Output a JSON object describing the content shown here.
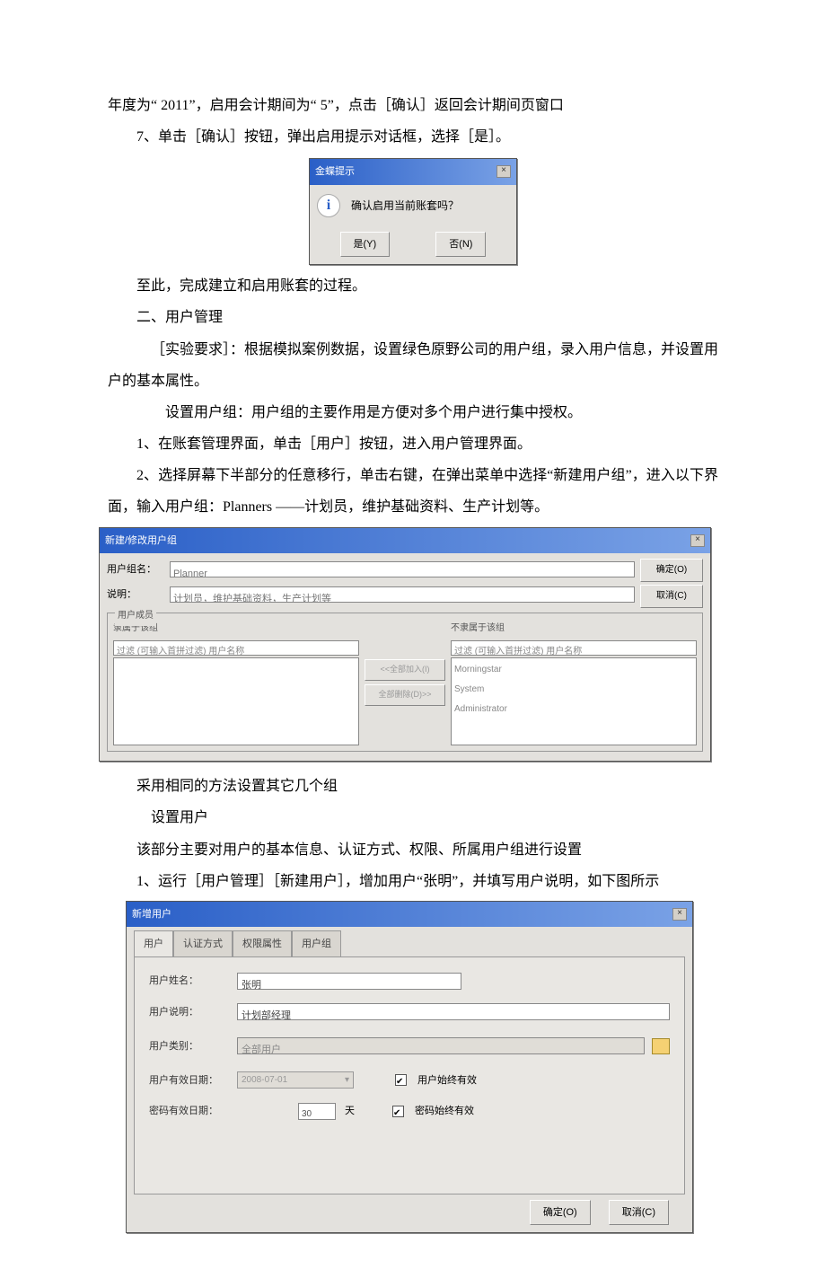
{
  "p_lead": "年度为“ 2011”，启用会计期间为“ 5”，点击［确认］返回会计期间页窗口",
  "p_step7": "7、单击［确认］按钮，弹出启用提示对话框，选择［是］。",
  "dlg_confirm": {
    "title": "金蝶提示",
    "message": "确认启用当前账套吗？",
    "btn_yes": "是(Y)",
    "btn_no": "否(N)"
  },
  "p_done": "至此，完成建立和启用账套的过程。",
  "p_h2": "二、用户管理",
  "p_req": "［实验要求］：根据模拟案例数据，设置绿色原野公司的用户组，录入用户信息，并设置用户的基本属性。",
  "p_setgroup": "设置用户组：用户组的主要作用是方便对多个用户进行集中授权。",
  "p_g1": "1、在账套管理界面，单击［用户］按钮，进入用户管理界面。",
  "p_g2a": "2、选择屏幕下半部分的任意移行，单击右键，在弹出菜单中选择“新建用户组”，进入以下界面，输入用户组：Planners ——计划员，维护基础资料、生产计划等。",
  "dlg_group": {
    "title": "新建/修改用户组",
    "lbl_name": "用户组名：",
    "val_name": "Planner",
    "lbl_desc": "说明：",
    "val_desc": "计划员，维护基础资料，生产计划等",
    "btn_ok": "确定(O)",
    "btn_cancel": "取消(C)",
    "box_legend": "用户成员",
    "left_sub": "隶属于该组",
    "left_filter": "过滤 (可输入首拼过滤) 用户名称",
    "right_sub": "不隶属于该组",
    "right_filter": "过滤 (可输入首拼过滤) 用户名称",
    "btn_addall": "<<全部加入(I)",
    "btn_removeall": "全部删除(D)>>",
    "right_list": "Morningstar\nSystem\nAdministrator"
  },
  "p_same": "采用相同的方法设置其它几个组",
  "p_setuser": "设置用户",
  "p_setuser_desc": "该部分主要对用户的基本信息、认证方式、权限、所属用户组进行设置",
  "p_u1": "1、运行［用户管理］［新建用户］，增加用户“张明”，并填写用户说明，如下图所示",
  "dlg_user": {
    "title": "新增用户",
    "tab1": "用户",
    "tab2": "认证方式",
    "tab3": "权限属性",
    "tab4": "用户组",
    "lbl_name": "用户姓名：",
    "val_name": "张明",
    "lbl_desc": "用户说明：",
    "val_desc": "计划部经理",
    "lbl_type": "用户类别：",
    "val_type": "全部用户",
    "lbl_valid": "用户有效日期：",
    "val_valid": "2008-07-01",
    "chk_valid": "用户始终有效",
    "lbl_pwd": "密码有效日期：",
    "val_pwd_days": "30",
    "unit_days": "天",
    "chk_pwd": "密码始终有效",
    "btn_ok": "确定(O)",
    "btn_cancel": "取消(C)"
  }
}
